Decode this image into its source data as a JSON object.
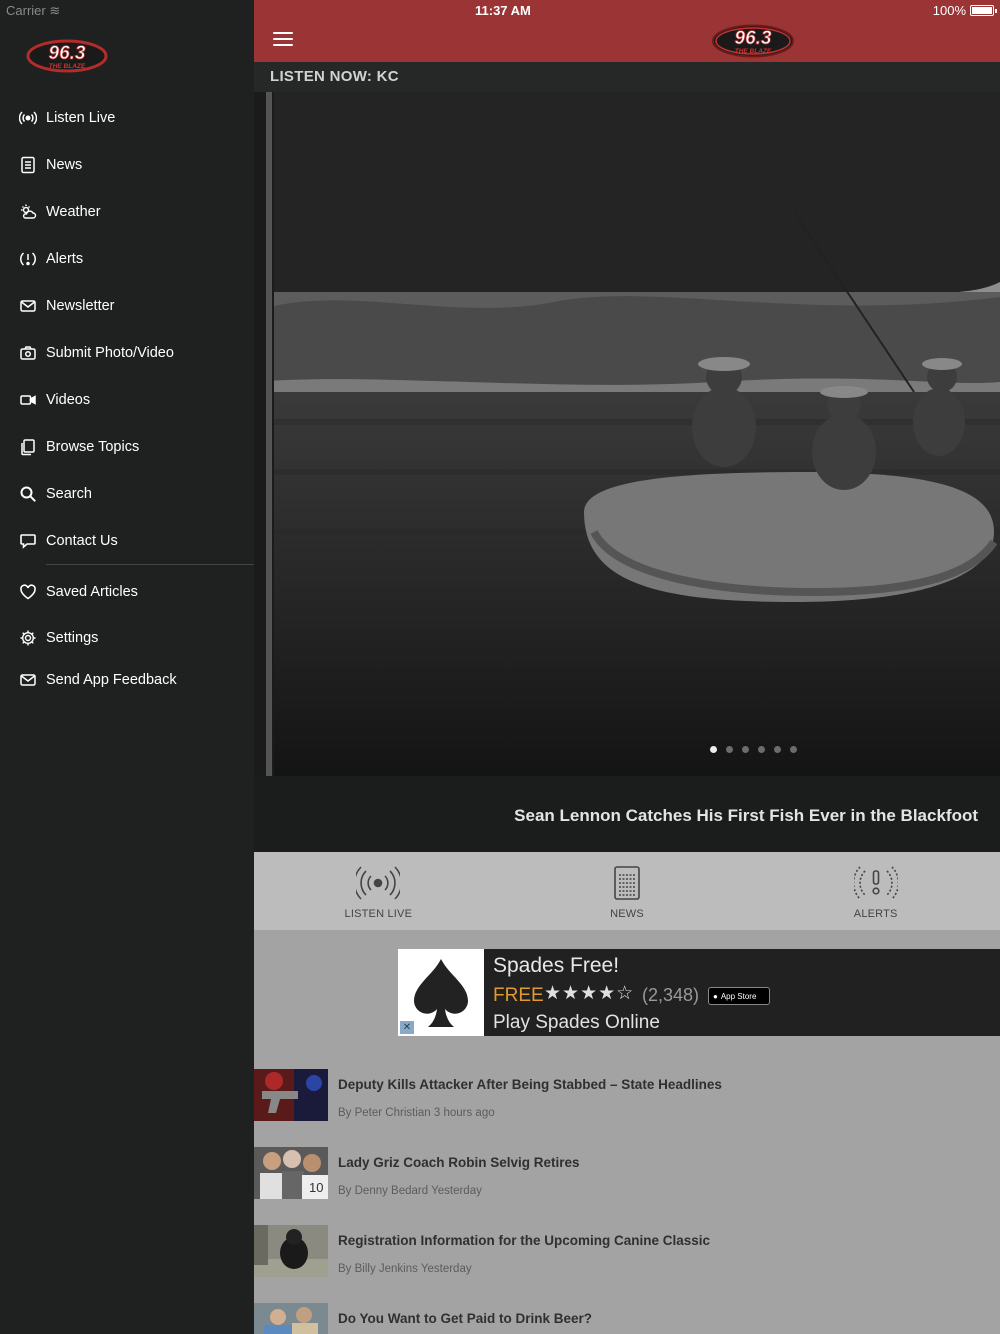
{
  "status": {
    "carrier": "Carrier",
    "time": "11:37 AM",
    "battery": "100%"
  },
  "logo": {
    "number": "96.3",
    "tagline": "THE BLAZE"
  },
  "sidebar": {
    "items": [
      {
        "label": "Listen Live",
        "icon": "broadcast-icon"
      },
      {
        "label": "News",
        "icon": "document-icon"
      },
      {
        "label": "Weather",
        "icon": "weather-icon"
      },
      {
        "label": "Alerts",
        "icon": "alert-icon"
      },
      {
        "label": "Newsletter",
        "icon": "mail-icon"
      },
      {
        "label": "Submit Photo/Video",
        "icon": "camera-icon"
      },
      {
        "label": "Videos",
        "icon": "video-icon"
      },
      {
        "label": "Browse Topics",
        "icon": "pages-icon"
      },
      {
        "label": "Search",
        "icon": "search-icon"
      },
      {
        "label": "Contact Us",
        "icon": "chat-icon"
      }
    ],
    "secondary": [
      {
        "label": "Saved Articles",
        "icon": "heart-icon"
      },
      {
        "label": "Settings",
        "icon": "gear-icon"
      },
      {
        "label": "Send App Feedback",
        "icon": "mail-icon"
      }
    ]
  },
  "main": {
    "listen_now": "LISTEN NOW: KC",
    "hero": {
      "caption": "Sean Lennon Catches His First Fish Ever in the Blackfoot",
      "slide_count": 6,
      "active_slide": 0
    },
    "quick_actions": [
      {
        "label": "LISTEN LIVE",
        "icon": "broadcast-icon"
      },
      {
        "label": "NEWS",
        "icon": "document-icon"
      },
      {
        "label": "ALERTS",
        "icon": "alert-icon"
      }
    ],
    "ad": {
      "title": "Spades Free!",
      "price": "FREE",
      "stars": "★★★★☆",
      "rating_count": "(2,348)",
      "store_badge": "App Store",
      "subtitle": "Play Spades Online"
    },
    "articles": [
      {
        "title": "Deputy Kills Attacker After Being Stabbed – State Headlines",
        "meta": "By Peter Christian 3 hours ago"
      },
      {
        "title": "Lady Griz Coach Robin Selvig Retires",
        "meta": "By Denny Bedard Yesterday"
      },
      {
        "title": "Registration Information for the Upcoming Canine Classic",
        "meta": "By Billy Jenkins Yesterday"
      },
      {
        "title": "Do You Want to Get Paid to Drink Beer?",
        "meta": ""
      }
    ]
  }
}
